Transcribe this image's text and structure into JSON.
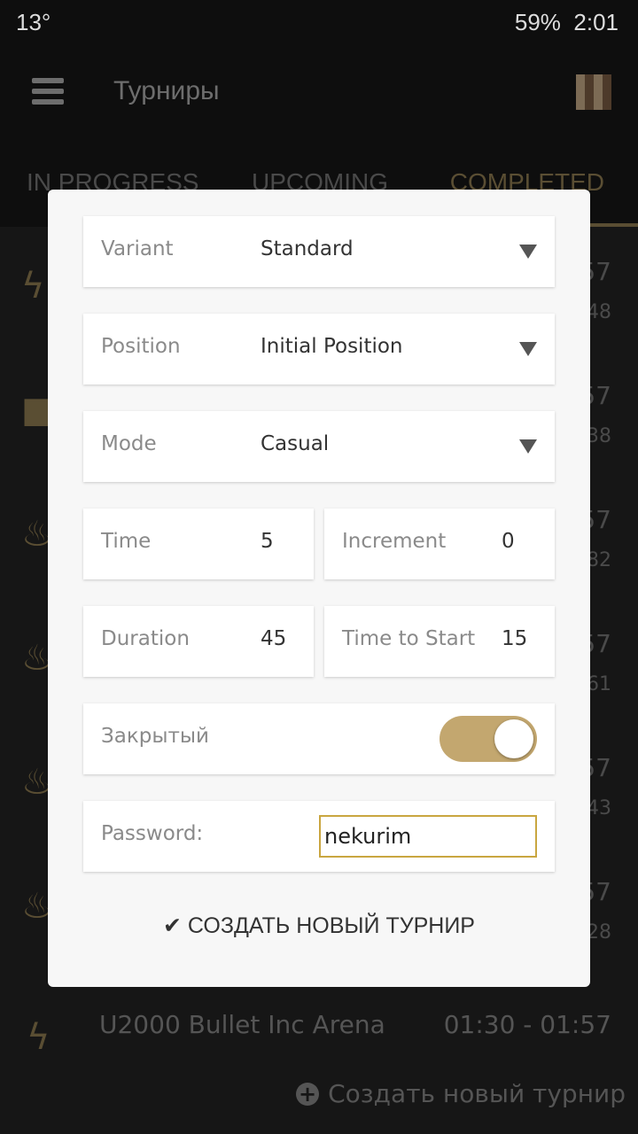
{
  "status": {
    "temp": "13°",
    "battery": "59%",
    "time": "2:01"
  },
  "appbar": {
    "title": "Турниры",
    "menu_icon": "hamburger-icon",
    "board_icon": "chessboard-icon"
  },
  "tabs": [
    {
      "label": "IN PROGRESS"
    },
    {
      "label": "UPCOMING"
    },
    {
      "label": "COMPLETED",
      "active": true
    }
  ],
  "bg_rows": [
    {
      "icon": "bolt-icon",
      "t1": "57",
      "t2": "48"
    },
    {
      "icon": "classical-icon",
      "t1": "57",
      "t2": "38"
    },
    {
      "icon": "flame-icon",
      "t1": "57",
      "t2": "82"
    },
    {
      "icon": "flame-icon",
      "t1": "57",
      "t2": "61"
    },
    {
      "icon": "flame-icon",
      "t1": "57",
      "t2": "43"
    },
    {
      "icon": "flame-icon",
      "t1": "57",
      "t2": "28"
    }
  ],
  "last_row": {
    "name": "U2000 Bullet Inc Arena",
    "time": "01:30 - 01:57"
  },
  "create_link": "Создать новый турнир",
  "dialog": {
    "variant": {
      "label": "Variant",
      "value": "Standard"
    },
    "position": {
      "label": "Position",
      "value": "Initial Position"
    },
    "mode": {
      "label": "Mode",
      "value": "Casual"
    },
    "time": {
      "label": "Time",
      "value": "5"
    },
    "increment": {
      "label": "Increment",
      "value": "0"
    },
    "duration": {
      "label": "Duration",
      "value": "45"
    },
    "time_to_start": {
      "label": "Time to Start",
      "value": "15"
    },
    "closed": {
      "label": "Закрытый",
      "on": true
    },
    "password": {
      "label": "Password:",
      "value": "nekurim"
    },
    "submit": "СОЗДАТЬ НОВЫЙ ТУРНИР",
    "accent": "#c3a76f"
  }
}
